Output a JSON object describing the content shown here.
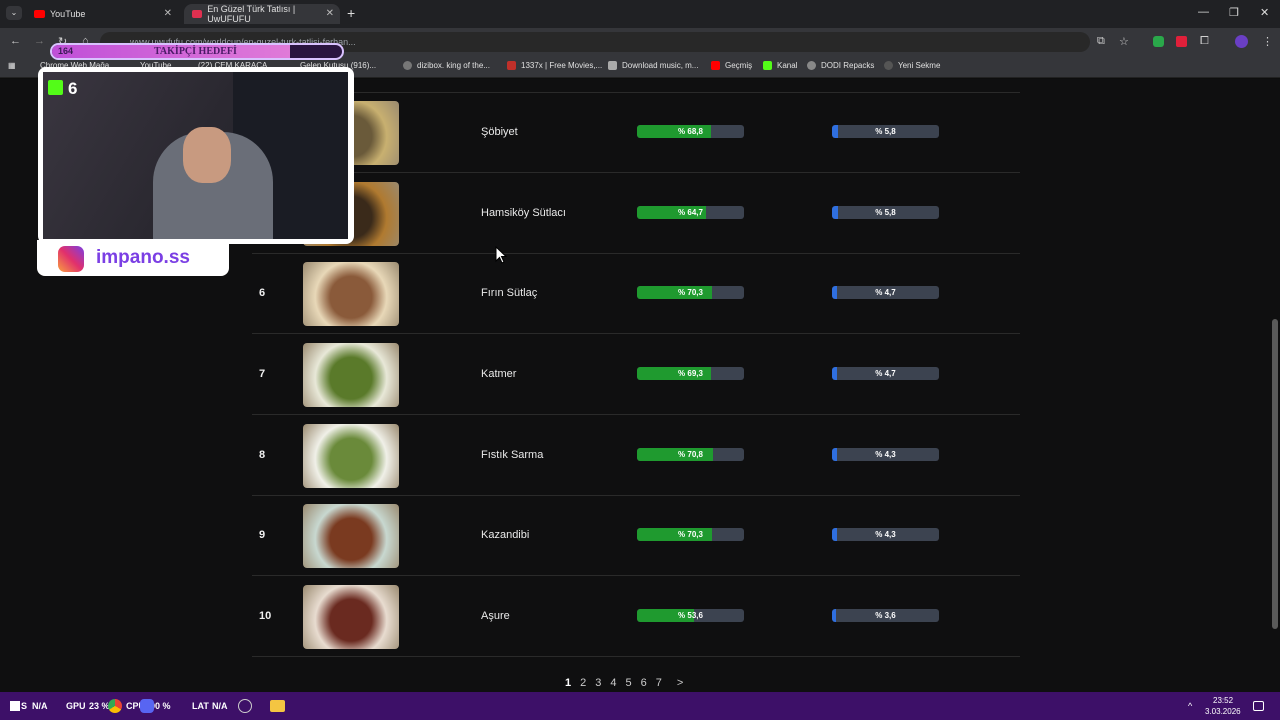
{
  "browser": {
    "tabs": [
      {
        "title": "YouTube",
        "active": false
      },
      {
        "title": "En Güzel Türk Tatlısı | UwUFUFU",
        "active": true
      }
    ],
    "new_tab": "+",
    "url": "www.uwufufu.com/worldcup/en-guzel-turk-tatlisi-ferhan...",
    "window_controls": [
      "—",
      "❐",
      "✕"
    ],
    "bookmarks": [
      {
        "label": "Chrome Web Mağa...",
        "icon": "chrome-icon"
      },
      {
        "label": "YouTube",
        "icon": "youtube-icon"
      },
      {
        "label": "(22) CEM KARACA...",
        "icon": "youtube-icon"
      },
      {
        "label": "Gelen Kutusu (916)...",
        "icon": "mail-icon"
      },
      {
        "label": "dizibox. king of the...",
        "icon": "globe-icon"
      },
      {
        "label": "1337x | Free Movies,...",
        "icon": "x-icon"
      },
      {
        "label": "Download music, m...",
        "icon": "download-icon"
      },
      {
        "label": "Geçmiş",
        "icon": "youtube-icon"
      },
      {
        "label": "Kanal",
        "icon": "kick-icon"
      },
      {
        "label": "DODI Repacks",
        "icon": "globe-icon"
      },
      {
        "label": "Yeni Sekme",
        "icon": "globe-icon"
      }
    ]
  },
  "overlay": {
    "follow_goal_count": "164",
    "follow_goal_label": "TAKİPÇİ HEDEFİ",
    "follow_goal_progress": 0.82,
    "kick_viewers": "6",
    "instagram_handle": "impano.ss"
  },
  "ranking": {
    "rows": [
      {
        "rank": "",
        "name": "Şöbiyet",
        "win_rate": "% 68,8",
        "win_value": 68.8,
        "champ_rate": "% 5,8",
        "champ_value": 5.8,
        "thumb_colors": [
          "#6a5a3a",
          "#c8b070"
        ]
      },
      {
        "rank": "",
        "name": "Hamsiköy Sütlacı",
        "win_rate": "% 64,7",
        "win_value": 64.7,
        "champ_rate": "% 5,8",
        "champ_value": 5.8,
        "thumb_colors": [
          "#3a2a1a",
          "#b07a30"
        ]
      },
      {
        "rank": "6",
        "name": "Fırın Sütlaç",
        "win_rate": "% 70,3",
        "win_value": 70.3,
        "champ_rate": "% 4,7",
        "champ_value": 4.7,
        "thumb_colors": [
          "#8a5a3a",
          "#e8d8b8"
        ]
      },
      {
        "rank": "7",
        "name": "Katmer",
        "win_rate": "% 69,3",
        "win_value": 69.3,
        "champ_rate": "% 4,7",
        "champ_value": 4.7,
        "thumb_colors": [
          "#5a7a2a",
          "#e8e8d8"
        ]
      },
      {
        "rank": "8",
        "name": "Fıstık Sarma",
        "win_rate": "% 70,8",
        "win_value": 70.8,
        "champ_rate": "% 4,3",
        "champ_value": 4.3,
        "thumb_colors": [
          "#6a8a3a",
          "#f0f0e8"
        ]
      },
      {
        "rank": "9",
        "name": "Kazandibi",
        "win_rate": "% 70,3",
        "win_value": 70.3,
        "champ_rate": "% 4,3",
        "champ_value": 4.3,
        "thumb_colors": [
          "#7a3a20",
          "#c8d8d0"
        ]
      },
      {
        "rank": "10",
        "name": "Aşure",
        "win_rate": "% 53,6",
        "win_value": 53.6,
        "champ_rate": "% 3,6",
        "champ_value": 3.6,
        "thumb_colors": [
          "#6a2a20",
          "#e8dcd0"
        ]
      }
    ]
  },
  "pagination": {
    "pages": [
      "1",
      "2",
      "3",
      "4",
      "5",
      "6",
      "7"
    ],
    "current": "1",
    "next": ">"
  },
  "taskbar": {
    "items": [
      "S",
      "N/A",
      "GPU",
      "23 %",
      "CPU",
      "00 %",
      "LAT",
      "N/A"
    ],
    "time": "23:52",
    "date": "3.03.2026"
  },
  "colors": {
    "win_bar": "#1f9a2f",
    "champ_bar": "#2f6fe0",
    "taskbar": "#3d1068",
    "overlay_accent": "#7b3fe4"
  }
}
